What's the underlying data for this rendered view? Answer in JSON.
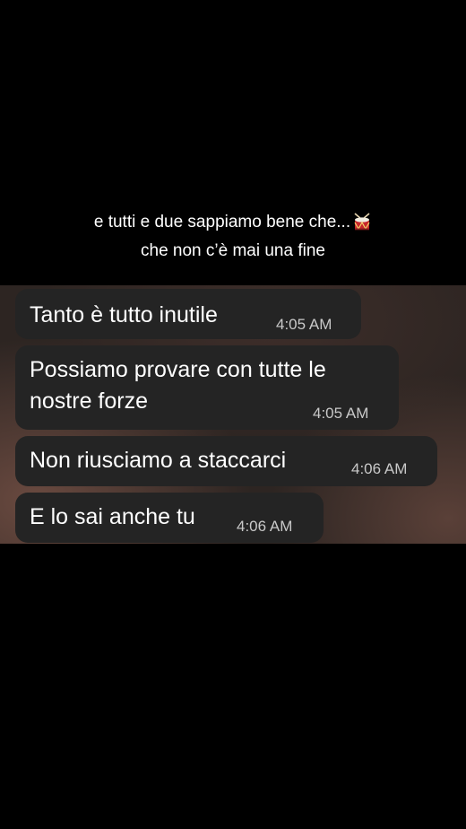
{
  "caption": {
    "line1": "e tutti e due sappiamo bene che...",
    "line1_emoji": "drum-icon",
    "line2": "che non c’è mai una fine"
  },
  "messages": [
    {
      "text": "Tanto è tutto inutile",
      "time": "4:05 AM"
    },
    {
      "text": "Possiamo provare con tutte le nostre forze",
      "time": "4:05 AM"
    },
    {
      "text": "Non riusciamo a staccarci",
      "time": "4:06 AM"
    },
    {
      "text": "E lo sai anche tu",
      "time": "4:06 AM"
    }
  ],
  "colors": {
    "background": "#000000",
    "bubble": "#242424",
    "text": "#ffffff",
    "timestamp": "#c9c9c9"
  }
}
